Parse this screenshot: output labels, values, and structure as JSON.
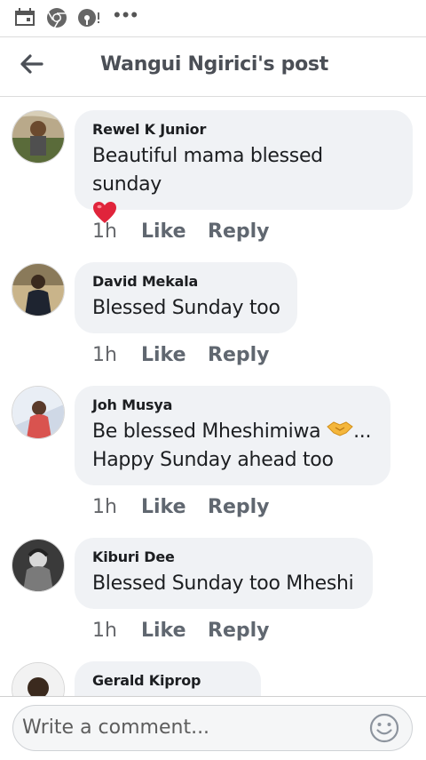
{
  "status_bar": {
    "icons": [
      "calendar-icon",
      "chrome-icon",
      "podcast-icon",
      "more-dots-icon"
    ]
  },
  "header": {
    "back_icon": "arrow-left-icon",
    "title": "Wangui Ngirici's post"
  },
  "comments": [
    {
      "author": "Rewel K Junior",
      "text": "Beautiful mama blessed sunday",
      "emoji": "heart-emoji",
      "time": "1h",
      "like_label": "Like",
      "reply_label": "Reply"
    },
    {
      "author": "David Mekala",
      "text": "Blessed Sunday too",
      "time": "1h",
      "like_label": "Like",
      "reply_label": "Reply"
    },
    {
      "author": "Joh Musya",
      "text_line1": "Be blessed Mheshimiwa",
      "text_line1_suffix": "...",
      "emoji": "handshake-emoji",
      "text_line2": "Happy Sunday ahead too",
      "time": "1h",
      "like_label": "Like",
      "reply_label": "Reply"
    },
    {
      "author": "Kiburi Dee",
      "text": "Blessed Sunday too Mheshi",
      "time": "1h",
      "like_label": "Like",
      "reply_label": "Reply"
    },
    {
      "author": "Gerald Kiprop"
    }
  ],
  "composer": {
    "placeholder": "Write a comment...",
    "emoji_icon": "smiley-icon"
  },
  "colors": {
    "bubble": "#f0f2f5",
    "meta_text": "#65676b",
    "heart": "#e0243b"
  }
}
